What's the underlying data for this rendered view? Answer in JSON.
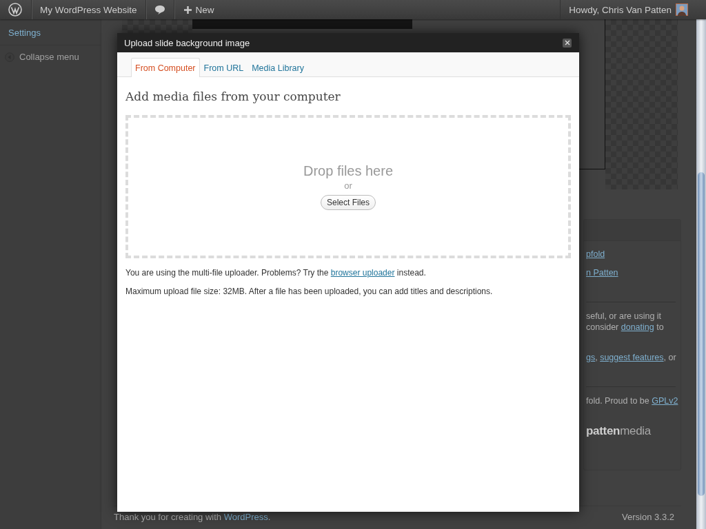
{
  "admin_bar": {
    "site": "My WordPress Website",
    "new": "New",
    "account": "Howdy, Chris Van Patten"
  },
  "sidebar": {
    "items": [
      {
        "label": "Settings",
        "kind": "link"
      },
      {
        "label": "Collapse menu",
        "kind": "collapse"
      }
    ]
  },
  "side_panel": {
    "lines": [
      [
        {
          "text": "pfold",
          "kind": "link"
        }
      ],
      [
        {
          "text": "n Patten",
          "kind": "link"
        }
      ],
      [
        {
          "text": "seful, or are using it",
          "kind": "text"
        }
      ],
      [
        {
          "text": "consider ",
          "kind": "text"
        },
        {
          "text": "donating",
          "kind": "link"
        },
        {
          "text": " to",
          "kind": "text"
        }
      ],
      [
        {
          "text": "gs",
          "kind": "link"
        },
        {
          "text": ", ",
          "kind": "text"
        },
        {
          "text": "suggest features",
          "kind": "link"
        },
        {
          "text": ", or",
          "kind": "text"
        }
      ],
      [
        {
          "text": "fold. Proud to be ",
          "kind": "text"
        },
        {
          "text": "GPLv2",
          "kind": "link"
        }
      ]
    ],
    "logo": "**patten**media"
  },
  "footer": {
    "thanks": "Thank you for creating with ",
    "thanks_link": "WordPress",
    "thanks_end": ".",
    "version": "Version 3.3.2"
  },
  "modal": {
    "title": "Upload slide background image",
    "tabs": [
      {
        "label": "From Computer",
        "selected": true
      },
      {
        "label": "From URL",
        "selected": false
      },
      {
        "label": "Media Library",
        "selected": false
      }
    ],
    "heading": "Add media files from your computer",
    "drop_text": "Drop files here",
    "or": "or",
    "select_button": "Select Files",
    "note_before": "You are using the multi-file uploader. Problems? Try the ",
    "note_link": "browser uploader",
    "note_after": " instead.",
    "max_size": "Maximum upload file size: 32MB. After a file has been uploaded, you can add titles and descriptions."
  }
}
